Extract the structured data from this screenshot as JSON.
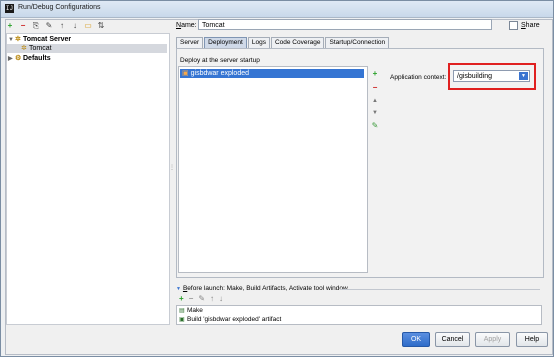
{
  "window": {
    "title": "Run/Debug Configurations",
    "app_icon": "IJ"
  },
  "left_toolbar": {
    "tools": [
      {
        "name": "add-icon",
        "glyph": "+"
      },
      {
        "name": "remove-icon",
        "glyph": "−"
      },
      {
        "name": "copy-icon",
        "glyph": "⎘"
      },
      {
        "name": "settings-icon",
        "glyph": "✎"
      },
      {
        "name": "move-up-icon",
        "glyph": "↑"
      },
      {
        "name": "move-down-icon",
        "glyph": "↓"
      },
      {
        "name": "folder-icon",
        "glyph": "▭"
      },
      {
        "name": "sort-icon",
        "glyph": "⇅"
      }
    ]
  },
  "tree": {
    "nodes": [
      {
        "label": "Tomcat Server",
        "arrow": "▼",
        "icon": "tomcat-icon",
        "glyph": "✲"
      },
      {
        "label": "Tomcat",
        "icon": "tomcat-icon",
        "glyph": "✲"
      },
      {
        "label": "Defaults",
        "arrow": "▶",
        "icon": "defaults-icon",
        "glyph": "⚙"
      }
    ]
  },
  "form": {
    "name_label": "ame:",
    "name_label_mnemonic": "N",
    "name_value": "Tomcat",
    "share_label": "hare",
    "share_label_mnemonic": "S"
  },
  "tabs": [
    "Server",
    "Deployment",
    "Logs",
    "Code Coverage",
    "Startup/Connection"
  ],
  "active_tab": "Deployment",
  "deployment": {
    "section_label": "Deploy at the server startup",
    "artifacts": [
      "gisbdwar exploded"
    ],
    "app_context_label": "Application context:",
    "app_context_value": "/gisbuilding"
  },
  "before_launch": {
    "header": "efore launch: Make, Build Artifacts, Activate tool window",
    "header_mnemonic": "B",
    "items": [
      "Make",
      "Build 'gisbdwar exploded' artifact"
    ]
  },
  "buttons": {
    "ok": "OK",
    "cancel": "Cancel",
    "apply": "Apply",
    "help": "Help"
  },
  "colors": {
    "selection": "#3575d3",
    "highlight": "#e02020",
    "add": "#2aa12a",
    "remove": "#cc2222"
  }
}
